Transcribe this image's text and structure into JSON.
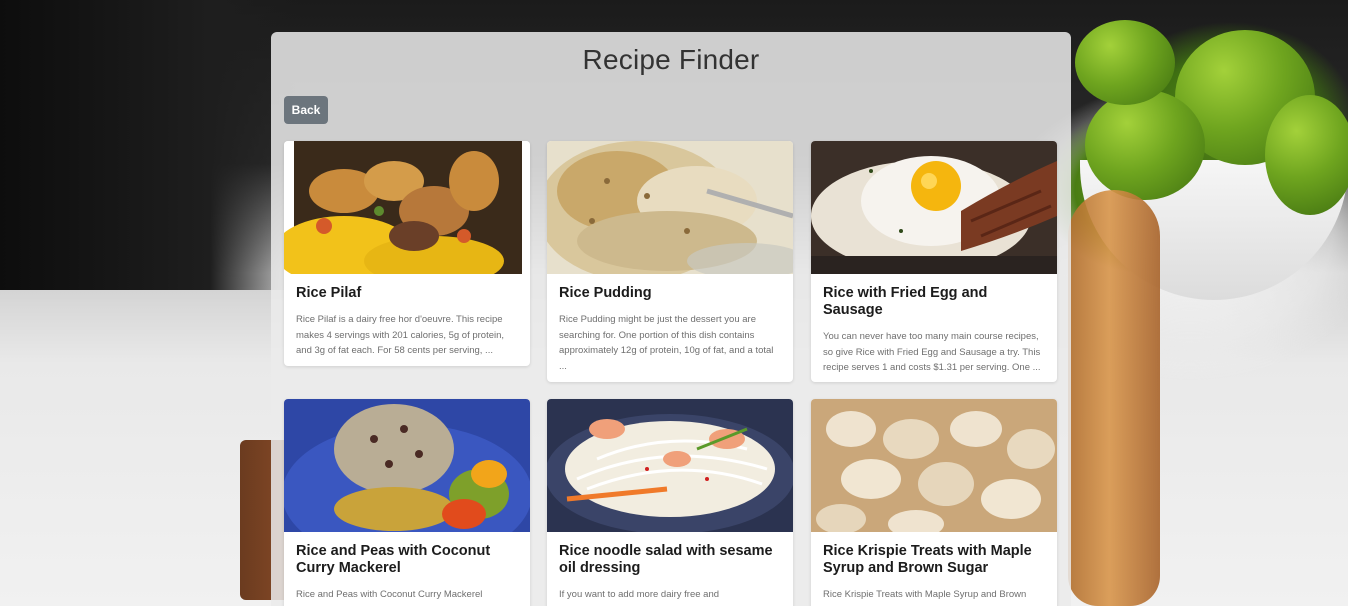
{
  "app": {
    "title": "Recipe Finder",
    "back_label": "Back"
  },
  "recipes": [
    {
      "title": "Rice Pilaf",
      "summary": "Rice Pilaf is a dairy free hor d'oeuvre. This recipe makes 4 servings with 201 calories, 5g of protein, and 3g of fat each. For 58 cents per serving, ...",
      "image_icon": "rice-pilaf-photo"
    },
    {
      "title": "Rice Pudding",
      "summary": "Rice Pudding might be just the dessert you are searching for. One portion of this dish contains approximately 12g of protein, 10g of fat, and a total ...",
      "image_icon": "rice-pudding-photo"
    },
    {
      "title": "Rice with Fried Egg and Sausage",
      "summary": "You can never have too many main course recipes, so give Rice with Fried Egg and Sausage a try. This recipe serves 1 and costs $1.31 per serving. One ...",
      "image_icon": "fried-egg-sausage-photo"
    },
    {
      "title": "Rice and Peas with Coconut Curry Mackerel",
      "summary": "Rice and Peas with Coconut Curry Mackerel",
      "image_icon": "rice-peas-mackerel-photo"
    },
    {
      "title": "Rice noodle salad with sesame oil dressing",
      "summary": "If you want to add more dairy free and",
      "image_icon": "rice-noodle-salad-photo"
    },
    {
      "title": "Rice Krispie Treats with Maple Syrup and Brown Sugar",
      "summary": "Rice Krispie Treats with Maple Syrup and Brown",
      "image_icon": "rice-krispie-treats-photo"
    }
  ]
}
